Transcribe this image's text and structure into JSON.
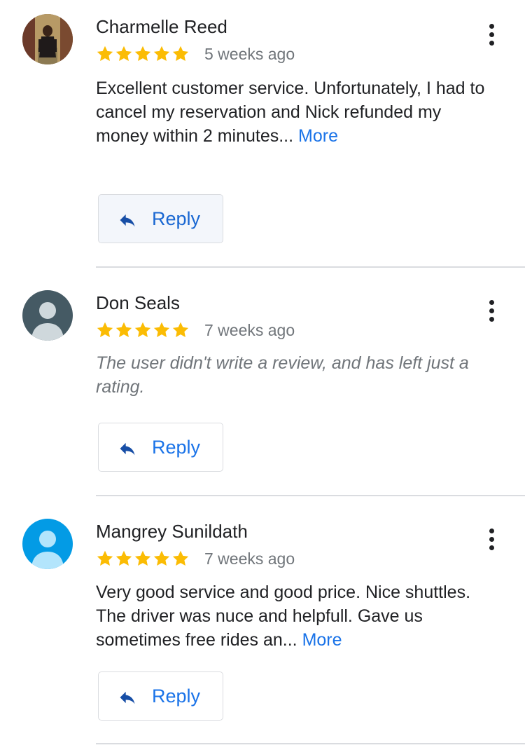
{
  "colors": {
    "star": "#fbbc04",
    "link": "#1a73e8",
    "meta_text": "#70757a",
    "divider": "#dadce0"
  },
  "reviews": [
    {
      "reviewer": "Charmelle Reed",
      "avatar_icon": "profile-photo",
      "rating": 5,
      "date": "5 weeks ago",
      "text": "Excellent customer service. Unfortunately, I had to cancel my reservation and Nick refunded my money within 2 minutes...",
      "more_label": "More",
      "reply_label": "Reply",
      "menu_icon": "more-vert-icon"
    },
    {
      "reviewer": "Don Seals",
      "avatar_icon": "default-person-icon",
      "avatar_color": "#455a64",
      "rating": 5,
      "date": "7 weeks ago",
      "text": "The user didn't write a review, and has left just a rating.",
      "reply_label": "Reply",
      "menu_icon": "more-vert-icon"
    },
    {
      "reviewer": "Mangrey Sunildath",
      "avatar_icon": "default-person-icon",
      "avatar_color": "#039be5",
      "rating": 5,
      "date": "7 weeks ago",
      "text": "Very good service and good price. Nice shuttles. The driver was nuce and helpfull. Gave us sometimes free rides an...",
      "more_label": "More",
      "reply_label": "Reply",
      "menu_icon": "more-vert-icon"
    }
  ]
}
